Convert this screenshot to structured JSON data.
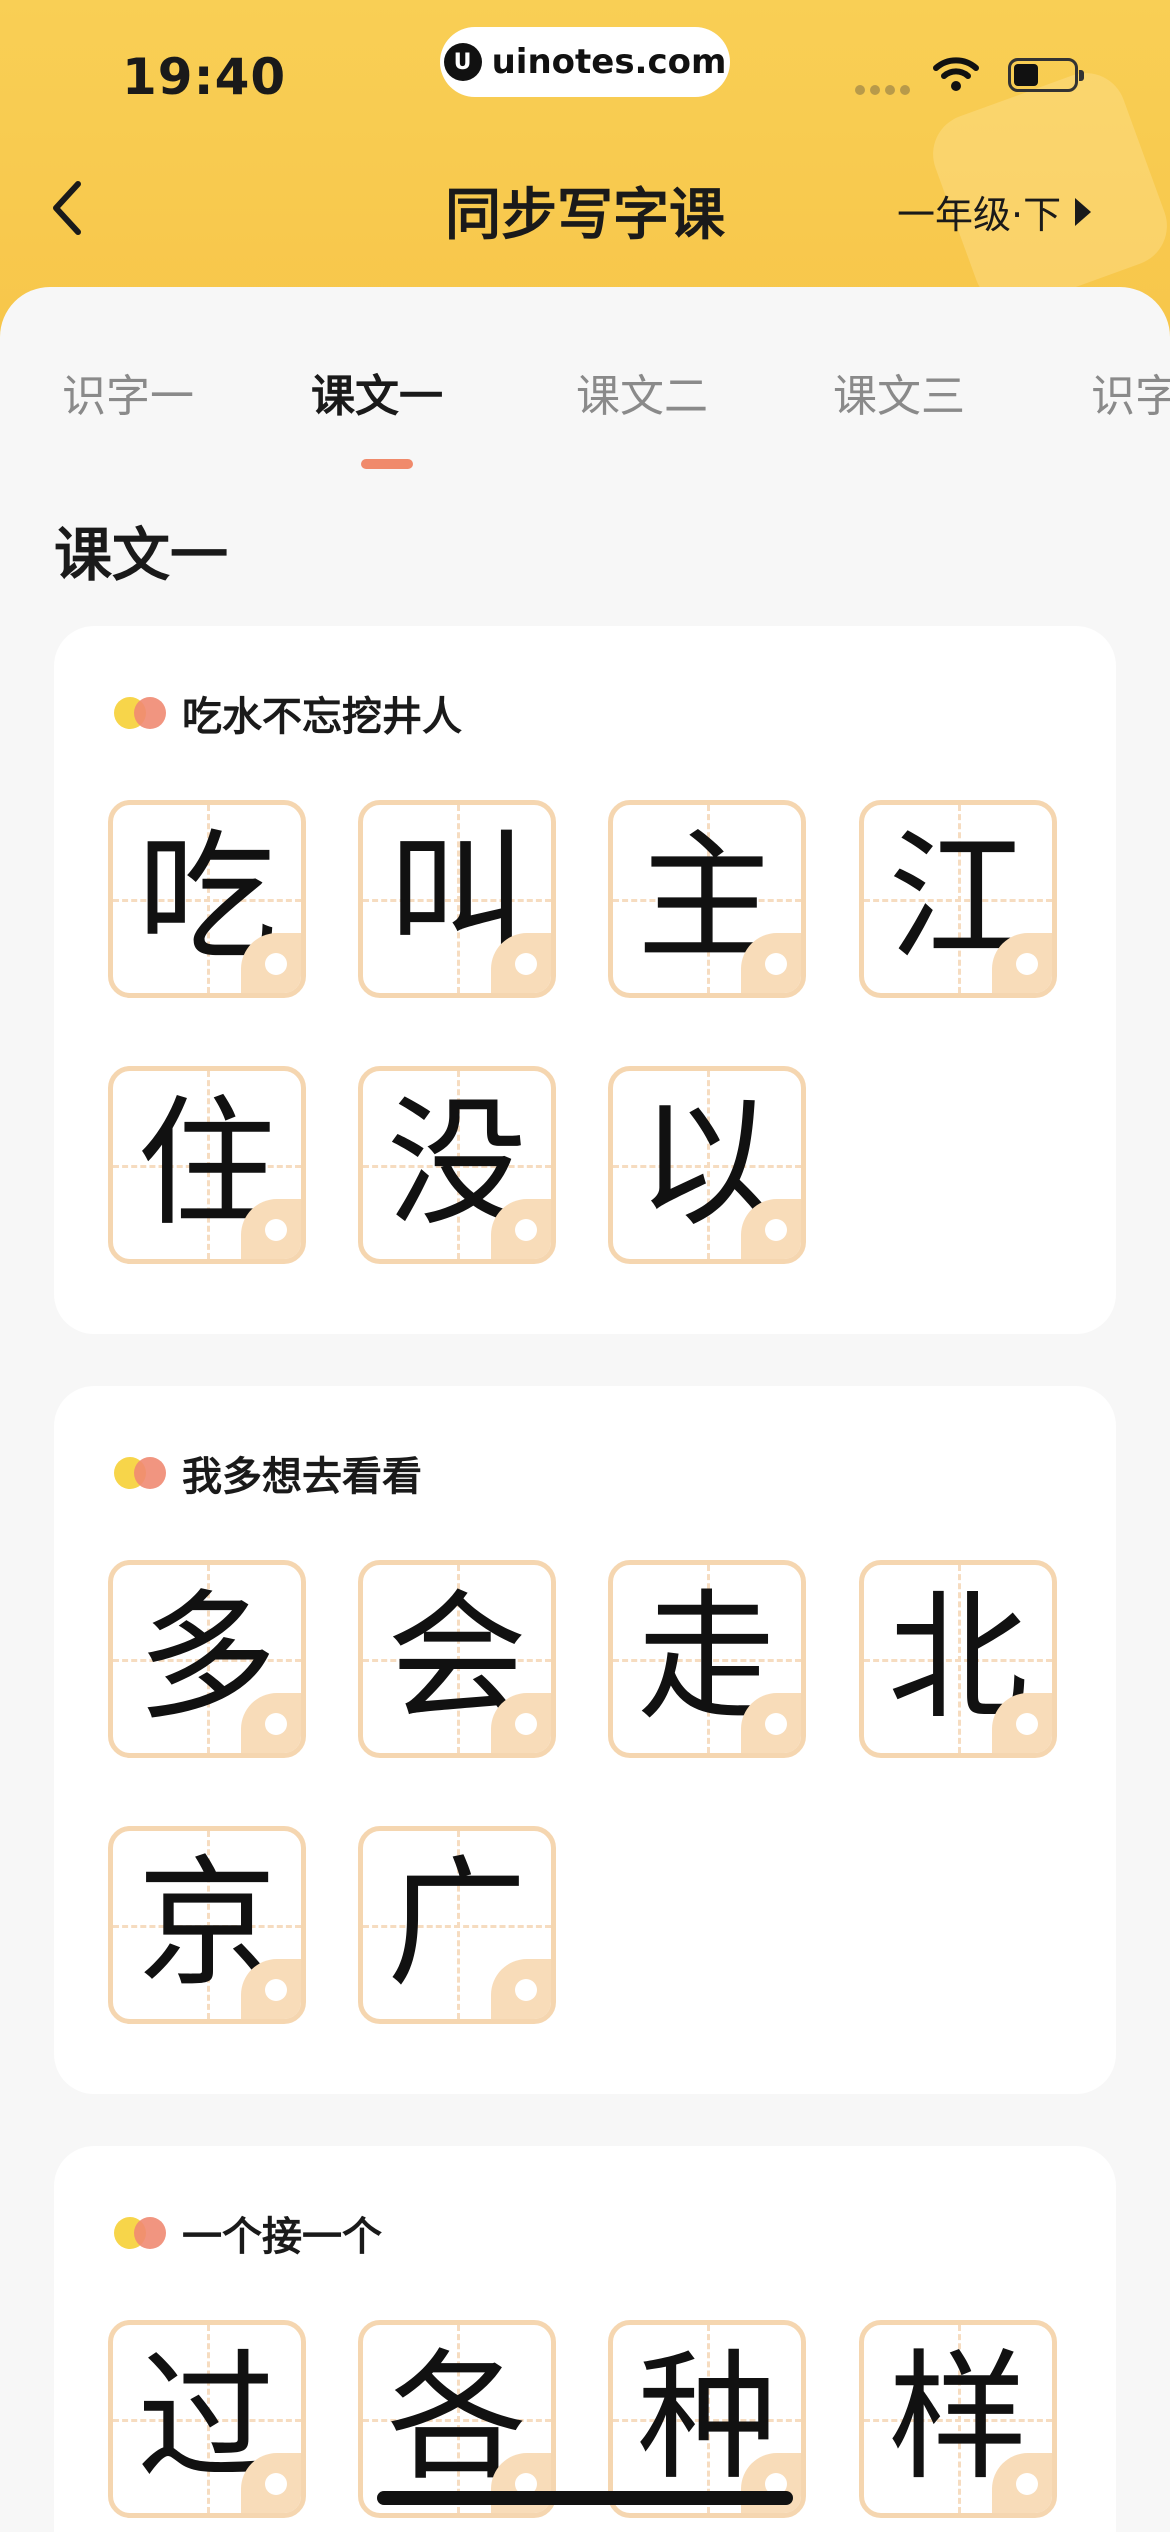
{
  "status_bar": {
    "time": "19:40",
    "url": "uinotes.com"
  },
  "header": {
    "title": "同步写字课",
    "grade": "一年级·下"
  },
  "tabs": [
    {
      "label": "识字一",
      "active": false
    },
    {
      "label": "课文一",
      "active": true
    },
    {
      "label": "课文二",
      "active": false
    },
    {
      "label": "课文三",
      "active": false
    },
    {
      "label": "识字",
      "active": false
    }
  ],
  "section": {
    "title": "课文一"
  },
  "cards": [
    {
      "title": "吃水不忘挖井人",
      "chars": [
        "吃",
        "叫",
        "主",
        "江",
        "住",
        "没",
        "以"
      ]
    },
    {
      "title": "我多想去看看",
      "chars": [
        "多",
        "会",
        "走",
        "北",
        "京",
        "广"
      ]
    },
    {
      "title": "一个接一个",
      "chars": [
        "过",
        "各",
        "种",
        "样"
      ]
    }
  ],
  "colors": {
    "header_bg": "#f9cf55",
    "tab_indicator": "#f08a6b",
    "grid_border": "#f5d6b0"
  },
  "icons": {
    "back": "chevron-left-icon",
    "grade": "triangle-right-icon",
    "play": "play-audio-icon"
  }
}
